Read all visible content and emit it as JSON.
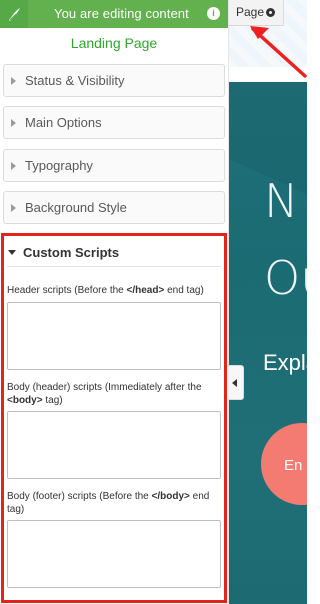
{
  "editing_bar": {
    "message": "You are editing content"
  },
  "editor": {
    "page_title": "Landing Page",
    "sections": [
      "Status & Visibility",
      "Main Options",
      "Typography",
      "Background Style"
    ],
    "custom_scripts": {
      "title": "Custom Scripts",
      "header_label_prefix": "Header scripts (Before the ",
      "header_label_tag": "</head>",
      "header_label_suffix": " end tag)",
      "body_header_label_prefix": "Body (header) scripts (Immediately after the ",
      "body_header_label_tag": "<body>",
      "body_header_label_suffix": " tag)",
      "body_footer_label_prefix": "Body (footer) scripts (Before the ",
      "body_footer_label_tag": "</body>",
      "body_footer_label_suffix": " end tag)",
      "header_scripts_value": "",
      "body_header_scripts_value": "",
      "body_footer_scripts_value": ""
    }
  },
  "preview": {
    "page_tab_label": "Page",
    "hero_word_1": "N",
    "hero_word_2": "Ou",
    "hero_subtitle": "Expla",
    "cta_label": "En"
  },
  "colors": {
    "editing_bar": "#62b04e",
    "page_title": "#2ea82d",
    "highlight": "#e52319",
    "hero_background": "#1f7079",
    "cta_background": "#f47b71"
  },
  "icons": {
    "logo": "leaf-logo-icon",
    "info": "info-icon",
    "settings": "gear-icon",
    "collapse": "chevron-left-icon",
    "annotation": "red-arrow-icon"
  }
}
